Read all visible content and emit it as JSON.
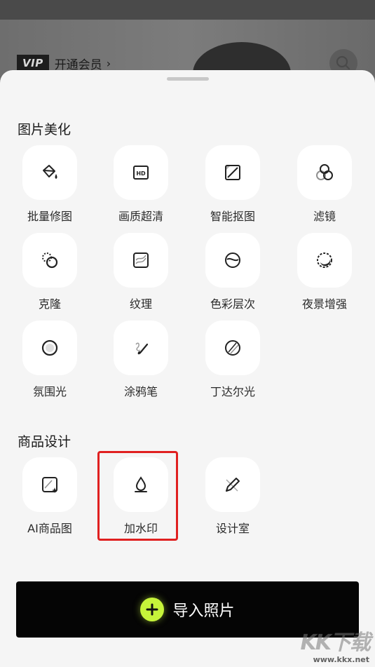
{
  "background_app": {
    "vip_badge": "VIP",
    "vip_text": "开通会员",
    "vip_chevron": "›",
    "search_icon": "search-icon"
  },
  "sheet": {
    "beautify_title": "图片美化",
    "beautify_tools": [
      {
        "label": "批量修图",
        "icon": "paint-bucket-icon"
      },
      {
        "label": "画质超清",
        "icon": "hd-icon"
      },
      {
        "label": "智能抠图",
        "icon": "cutout-icon"
      },
      {
        "label": "滤镜",
        "icon": "filter-icon"
      },
      {
        "label": "克隆",
        "icon": "clone-icon"
      },
      {
        "label": "纹理",
        "icon": "texture-icon"
      },
      {
        "label": "色彩层次",
        "icon": "color-level-icon"
      },
      {
        "label": "夜景增强",
        "icon": "night-moon-icon"
      },
      {
        "label": "氛围光",
        "icon": "ambient-light-icon"
      },
      {
        "label": "涂鸦笔",
        "icon": "brush-icon"
      },
      {
        "label": "丁达尔光",
        "icon": "tyndall-light-icon"
      }
    ],
    "design_title": "商品设计",
    "design_tools": [
      {
        "label": "AI商品图",
        "icon": "ai-product-icon"
      },
      {
        "label": "加水印",
        "icon": "watermark-drop-icon"
      },
      {
        "label": "设计室",
        "icon": "design-pencil-icon"
      }
    ],
    "import_button": "导入照片",
    "plus_icon": "plus-icon"
  },
  "watermark": {
    "main": "KK下载",
    "url": "www.kkx.net"
  },
  "colors": {
    "accent": "#c6f43a",
    "highlight": "#e02020",
    "button_bg": "#050505"
  }
}
